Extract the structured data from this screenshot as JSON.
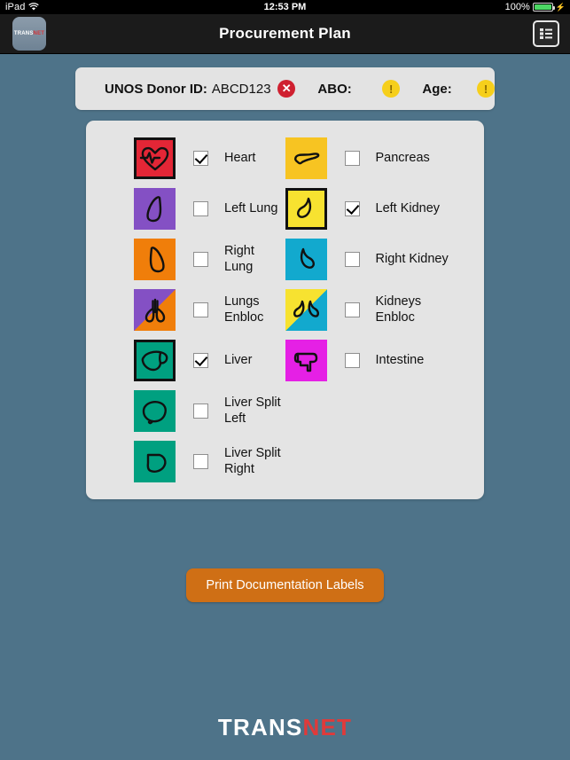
{
  "statusbar": {
    "device": "iPad",
    "wifi_icon": "wifi-icon",
    "time": "12:53 PM",
    "battery_percent": "100%",
    "battery_icon": "battery-icon",
    "charging_icon": "lightning-bolt-icon"
  },
  "navbar": {
    "title": "Procurement Plan",
    "logo_primary": "TRANS",
    "logo_accent": "NET",
    "logo_icon": "transnet-app-logo",
    "menu_icon": "list-grid-icon"
  },
  "donor_info": {
    "donor_id_label": "UNOS Donor ID:",
    "donor_id_value": "ABCD123",
    "donor_id_status_icon": "error-circle-icon",
    "donor_id_status_glyph": "✕",
    "abo_label": "ABO:",
    "abo_status_icon": "warning-circle-icon",
    "abo_status_glyph": "!",
    "age_label": "Age:",
    "age_status_icon": "warning-circle-icon",
    "age_status_glyph": "!"
  },
  "organs": {
    "left_column": [
      {
        "name": "Heart",
        "icon": "heart-icon",
        "checked": true,
        "selected": true,
        "color": "#e32636",
        "color2": null,
        "check_icon": "checked-checkbox-icon"
      },
      {
        "name": "Left Lung",
        "icon": "left-lung-icon",
        "checked": false,
        "selected": false,
        "color": "#8450c4",
        "color2": null,
        "check_icon": "unchecked-checkbox-icon"
      },
      {
        "name": "Right Lung",
        "icon": "right-lung-icon",
        "checked": false,
        "selected": false,
        "color": "#f07e0a",
        "color2": null,
        "check_icon": "unchecked-checkbox-icon"
      },
      {
        "name": "Lungs Enbloc",
        "icon": "lungs-enbloc-icon",
        "checked": false,
        "selected": false,
        "color": "#8450c4",
        "color2": "#f07e0a",
        "check_icon": "unchecked-checkbox-icon"
      },
      {
        "name": "Liver",
        "icon": "liver-icon",
        "checked": true,
        "selected": true,
        "color": "#00a080",
        "color2": null,
        "check_icon": "checked-checkbox-icon"
      },
      {
        "name": "Liver Split Left",
        "icon": "liver-split-left-icon",
        "checked": false,
        "selected": false,
        "color": "#00a080",
        "color2": null,
        "check_icon": "unchecked-checkbox-icon"
      },
      {
        "name": "Liver Split\nRight",
        "icon": "liver-split-right-icon",
        "checked": false,
        "selected": false,
        "color": "#00a080",
        "color2": null,
        "check_icon": "unchecked-checkbox-icon"
      }
    ],
    "right_column": [
      {
        "name": "Pancreas",
        "icon": "pancreas-icon",
        "checked": false,
        "selected": false,
        "color": "#f7c422",
        "color2": null,
        "check_icon": "unchecked-checkbox-icon"
      },
      {
        "name": "Left Kidney",
        "icon": "left-kidney-icon",
        "checked": true,
        "selected": true,
        "color": "#f7e230",
        "color2": null,
        "check_icon": "checked-checkbox-icon"
      },
      {
        "name": "Right Kidney",
        "icon": "right-kidney-icon",
        "checked": false,
        "selected": false,
        "color": "#12a9ce",
        "color2": null,
        "check_icon": "unchecked-checkbox-icon"
      },
      {
        "name": "Kidneys\nEnbloc",
        "icon": "kidneys-enbloc-icon",
        "checked": false,
        "selected": false,
        "color": "#f7e230",
        "color2": "#12a9ce",
        "check_icon": "unchecked-checkbox-icon"
      },
      {
        "name": "Intestine",
        "icon": "intestine-icon",
        "checked": false,
        "selected": false,
        "color": "#e520e5",
        "color2": null,
        "check_icon": "unchecked-checkbox-icon"
      }
    ]
  },
  "actions": {
    "print_label": "Print Documentation Labels"
  },
  "footer": {
    "logo_primary": "TRANS",
    "logo_accent": "NET"
  },
  "theme": {
    "background": "#4e7389",
    "card_background": "#e4e4e4",
    "navbar_background": "#1b1b1b",
    "accent_button": "#cf6f15",
    "error": "#cf2030",
    "warning": "#f6cf1b",
    "logo_accent": "#e03a3a"
  }
}
